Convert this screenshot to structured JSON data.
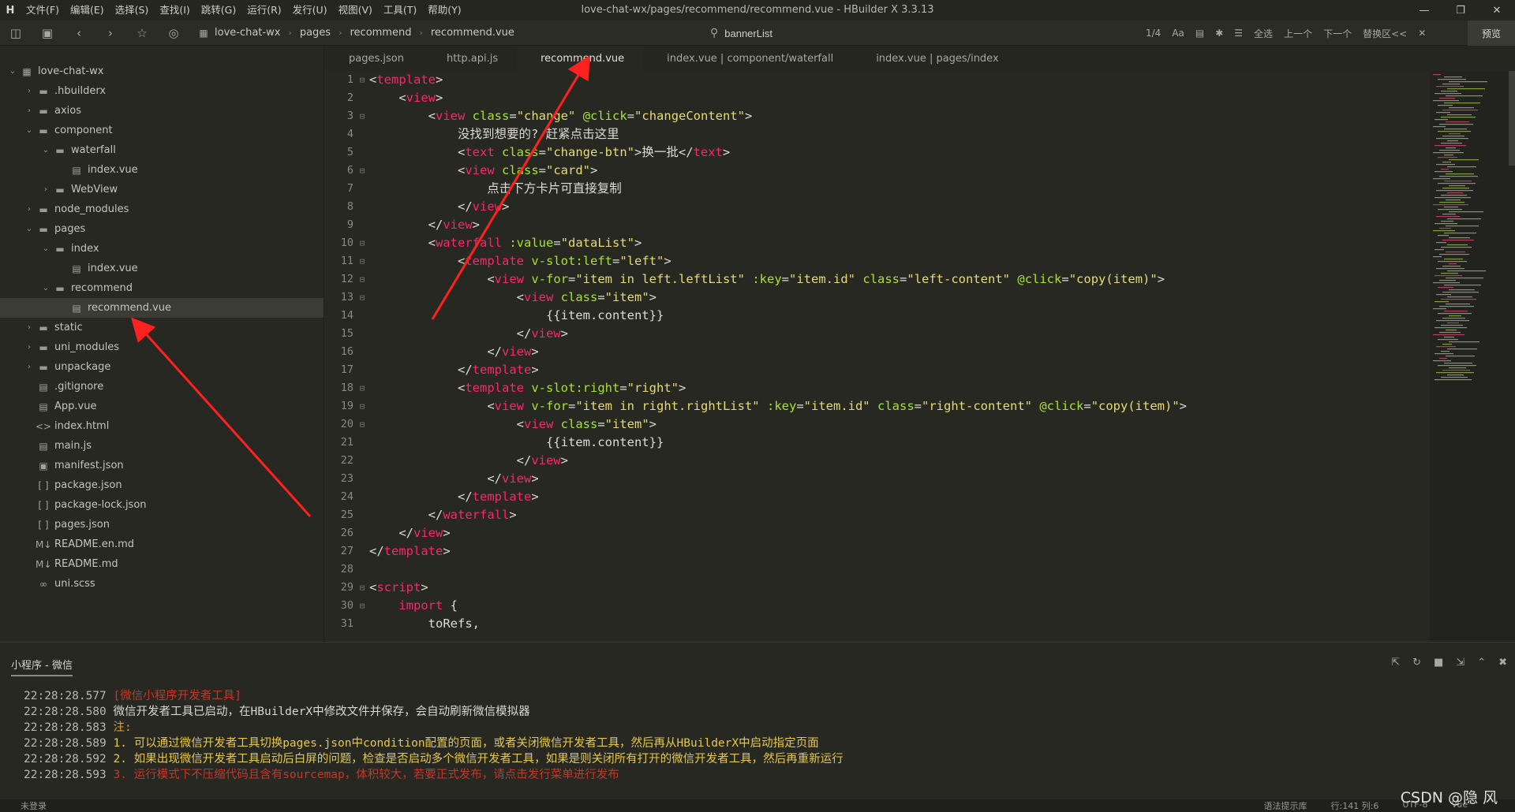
{
  "window": {
    "title": "love-chat-wx/pages/recommend/recommend.vue - HBuilder X 3.3.13",
    "logo": "H"
  },
  "menu": [
    "文件(F)",
    "编辑(E)",
    "选择(S)",
    "查找(I)",
    "跳转(G)",
    "运行(R)",
    "发行(U)",
    "视图(V)",
    "工具(T)",
    "帮助(Y)"
  ],
  "toolbar": {
    "breadcrumb": [
      "love-chat-wx",
      "pages",
      "recommend",
      "recommend.vue"
    ],
    "search_value": "bannerList",
    "match_count": "1/4",
    "case_label": "Aa",
    "select_all": "全选",
    "prev": "上一个",
    "next": "下一个",
    "replace": "替换区<<",
    "preview": "预览"
  },
  "sidebar": {
    "items": [
      {
        "label": "love-chat-wx",
        "depth": 0,
        "type": "project",
        "expanded": true
      },
      {
        "label": ".hbuilderx",
        "depth": 1,
        "type": "folder",
        "expanded": false
      },
      {
        "label": "axios",
        "depth": 1,
        "type": "folder",
        "expanded": false
      },
      {
        "label": "component",
        "depth": 1,
        "type": "folder",
        "expanded": true
      },
      {
        "label": "waterfall",
        "depth": 2,
        "type": "folder",
        "expanded": true
      },
      {
        "label": "index.vue",
        "depth": 3,
        "type": "file"
      },
      {
        "label": "WebView",
        "depth": 2,
        "type": "folder",
        "expanded": false
      },
      {
        "label": "node_modules",
        "depth": 1,
        "type": "folder",
        "expanded": false
      },
      {
        "label": "pages",
        "depth": 1,
        "type": "folder",
        "expanded": true
      },
      {
        "label": "index",
        "depth": 2,
        "type": "folder",
        "expanded": true
      },
      {
        "label": "index.vue",
        "depth": 3,
        "type": "file"
      },
      {
        "label": "recommend",
        "depth": 2,
        "type": "folder",
        "expanded": true
      },
      {
        "label": "recommend.vue",
        "depth": 3,
        "type": "file",
        "selected": true
      },
      {
        "label": "static",
        "depth": 1,
        "type": "folder",
        "expanded": false
      },
      {
        "label": "uni_modules",
        "depth": 1,
        "type": "folder",
        "expanded": false
      },
      {
        "label": "unpackage",
        "depth": 1,
        "type": "folder",
        "expanded": false
      },
      {
        "label": ".gitignore",
        "depth": 1,
        "type": "file"
      },
      {
        "label": "App.vue",
        "depth": 1,
        "type": "file"
      },
      {
        "label": "index.html",
        "depth": 1,
        "type": "html"
      },
      {
        "label": "main.js",
        "depth": 1,
        "type": "file"
      },
      {
        "label": "manifest.json",
        "depth": 1,
        "type": "manifest"
      },
      {
        "label": "package.json",
        "depth": 1,
        "type": "json"
      },
      {
        "label": "package-lock.json",
        "depth": 1,
        "type": "json"
      },
      {
        "label": "pages.json",
        "depth": 1,
        "type": "json"
      },
      {
        "label": "README.en.md",
        "depth": 1,
        "type": "md"
      },
      {
        "label": "README.md",
        "depth": 1,
        "type": "md"
      },
      {
        "label": "uni.scss",
        "depth": 1,
        "type": "scss"
      }
    ]
  },
  "tabs": [
    {
      "label": "pages.json",
      "active": false
    },
    {
      "label": "http.api.js",
      "active": false
    },
    {
      "label": "recommend.vue",
      "active": true
    },
    {
      "label": "index.vue | component/waterfall",
      "active": false
    },
    {
      "label": "index.vue | pages/index",
      "active": false
    }
  ],
  "code": [
    {
      "n": "1",
      "fold": "⊟",
      "text": "<template>"
    },
    {
      "n": "2",
      "fold": "",
      "text": "    <view>"
    },
    {
      "n": "3",
      "fold": "⊟",
      "text": "        <view class=\"change\" @click=\"changeContent\">"
    },
    {
      "n": "4",
      "fold": "",
      "text": "            没找到想要的? 赶紧点击这里"
    },
    {
      "n": "5",
      "fold": "",
      "text": "            <text class=\"change-btn\">换一批</text>"
    },
    {
      "n": "6",
      "fold": "⊟",
      "text": "            <view class=\"card\">"
    },
    {
      "n": "7",
      "fold": "",
      "text": "                点击下方卡片可直接复制"
    },
    {
      "n": "8",
      "fold": "",
      "text": "            </view>"
    },
    {
      "n": "9",
      "fold": "",
      "text": "        </view>"
    },
    {
      "n": "10",
      "fold": "⊟",
      "text": "        <waterfall :value=\"dataList\">"
    },
    {
      "n": "11",
      "fold": "⊟",
      "text": "            <template v-slot:left=\"left\">"
    },
    {
      "n": "12",
      "fold": "⊟",
      "text": "                <view v-for=\"item in left.leftList\" :key=\"item.id\" class=\"left-content\" @click=\"copy(item)\">"
    },
    {
      "n": "13",
      "fold": "⊟",
      "text": "                    <view class=\"item\">"
    },
    {
      "n": "14",
      "fold": "",
      "text": "                        {{item.content}}"
    },
    {
      "n": "15",
      "fold": "",
      "text": "                    </view>"
    },
    {
      "n": "16",
      "fold": "",
      "text": "                </view>"
    },
    {
      "n": "17",
      "fold": "",
      "text": "            </template>"
    },
    {
      "n": "18",
      "fold": "⊟",
      "text": "            <template v-slot:right=\"right\">"
    },
    {
      "n": "19",
      "fold": "⊟",
      "text": "                <view v-for=\"item in right.rightList\" :key=\"item.id\" class=\"right-content\" @click=\"copy(item)\">"
    },
    {
      "n": "20",
      "fold": "⊟",
      "text": "                    <view class=\"item\">"
    },
    {
      "n": "21",
      "fold": "",
      "text": "                        {{item.content}}"
    },
    {
      "n": "22",
      "fold": "",
      "text": "                    </view>"
    },
    {
      "n": "23",
      "fold": "",
      "text": "                </view>"
    },
    {
      "n": "24",
      "fold": "",
      "text": "            </template>"
    },
    {
      "n": "25",
      "fold": "",
      "text": "        </waterfall>"
    },
    {
      "n": "26",
      "fold": "",
      "text": "    </view>"
    },
    {
      "n": "27",
      "fold": "",
      "text": "</template>"
    },
    {
      "n": "28",
      "fold": "",
      "text": ""
    },
    {
      "n": "29",
      "fold": "⊟",
      "text": "<script>"
    },
    {
      "n": "30",
      "fold": "⊟",
      "text": "    import {"
    },
    {
      "n": "31",
      "fold": "",
      "text": "        toRefs,"
    }
  ],
  "console": {
    "tab_label": "小程序 - 微信",
    "lines": [
      {
        "time": "22:28:28.577",
        "text": "[微信小程序开发者工具]",
        "color": "red"
      },
      {
        "time": "22:28:28.580",
        "text": "微信开发者工具已启动，在HBuilderX中修改文件并保存，会自动刷新微信模拟器",
        "color": "white"
      },
      {
        "time": "22:28:28.583",
        "text": "注:",
        "color": "orange"
      },
      {
        "time": "22:28:28.589",
        "text": "1. 可以通过微信开发者工具切换pages.json中condition配置的页面，或者关闭微信开发者工具，然后再从HBuilderX中启动指定页面",
        "color": "yellow"
      },
      {
        "time": "22:28:28.592",
        "text": "2. 如果出现微信开发者工具启动后白屏的问题，检查是否启动多个微信开发者工具，如果是则关闭所有打开的微信开发者工具，然后再重新运行",
        "color": "yellow"
      },
      {
        "time": "22:28:28.593",
        "text": "3. 运行模式下不压缩代码且含有sourcemap，体积较大，若要正式发布，请点击发行菜单进行发布",
        "color": "red"
      }
    ]
  },
  "status": {
    "login": "未登录",
    "hint": "语法提示库",
    "position": "行:141  列:6",
    "encoding": "UTF-8",
    "language": "Vue"
  },
  "watermark": "CSDN @隐 风",
  "colors": {
    "background": "#272822",
    "tag": "#f92672",
    "attr": "#a6e22e",
    "string": "#e6db74",
    "arrow": "#ff2020"
  }
}
